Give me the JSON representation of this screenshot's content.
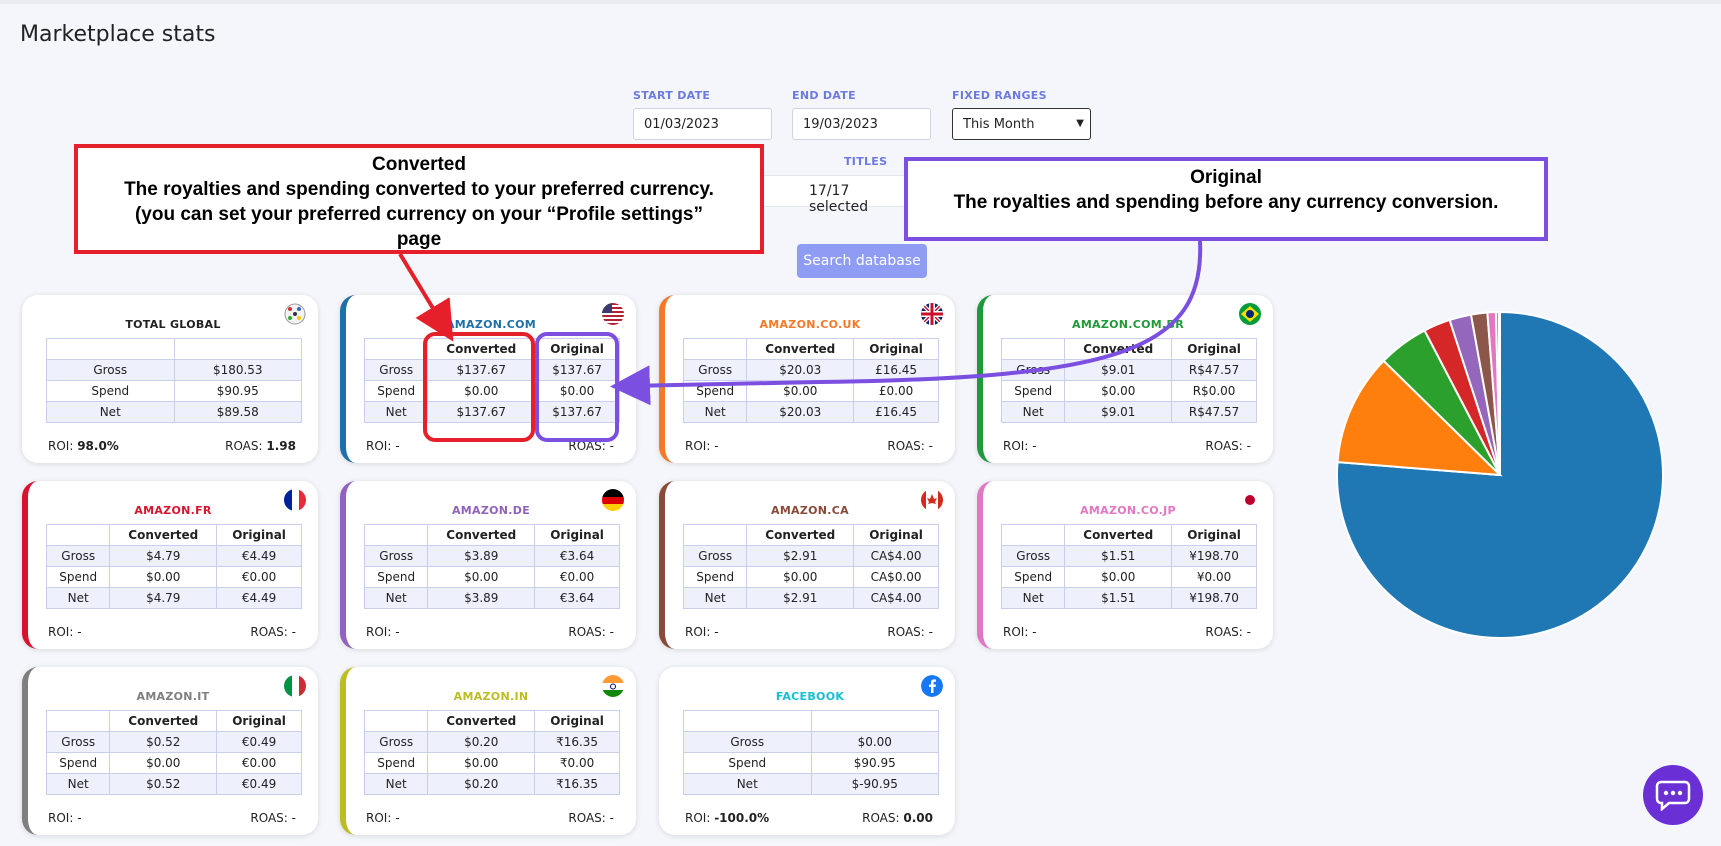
{
  "page": {
    "title": "Marketplace stats"
  },
  "filters": {
    "start_label": "START DATE",
    "start_value": "01/03/2023",
    "end_label": "END DATE",
    "end_value": "19/03/2023",
    "ranges_label": "FIXED RANGES",
    "ranges_value": "This Month",
    "titles_label": "TITLES",
    "titles_value": "17/17 selected",
    "search_button": "Search database"
  },
  "annotations": {
    "converted_title": "Converted",
    "converted_line1": "The royalties and spending converted to your preferred currency.",
    "converted_line2": "(you can set your preferred currency on your “Profile settings”",
    "converted_line3": "page",
    "original_title": "Original",
    "original_line1": "The royalties and spending before any currency conversion."
  },
  "labels": {
    "converted": "Converted",
    "original": "Original",
    "gross": "Gross",
    "spend": "Spend",
    "net": "Net",
    "roi": "ROI:",
    "roas": "ROAS:"
  },
  "cards": [
    {
      "name": "TOTAL GLOBAL",
      "color": "#222222",
      "flag": "globe",
      "gross_c": "$180.53",
      "spend_c": "$90.95",
      "net_c": "$89.58",
      "roi": "98.0%",
      "roas": "1.98"
    },
    {
      "name": "AMAZON.COM",
      "color": "#1f6fa8",
      "flag": "us",
      "gross_c": "$137.67",
      "gross_o": "$137.67",
      "spend_c": "$0.00",
      "spend_o": "$0.00",
      "net_c": "$137.67",
      "net_o": "$137.67",
      "roi": "-",
      "roas": "-"
    },
    {
      "name": "AMAZON.CO.UK",
      "color": "#f47a2a",
      "flag": "uk",
      "gross_c": "$20.03",
      "gross_o": "£16.45",
      "spend_c": "$0.00",
      "spend_o": "£0.00",
      "net_c": "$20.03",
      "net_o": "£16.45",
      "roi": "-",
      "roas": "-"
    },
    {
      "name": "AMAZON.COM.BR",
      "color": "#1f9a3a",
      "flag": "br",
      "gross_c": "$9.01",
      "gross_o": "R$47.57",
      "spend_c": "$0.00",
      "spend_o": "R$0.00",
      "net_c": "$9.01",
      "net_o": "R$47.57",
      "roi": "-",
      "roas": "-"
    },
    {
      "name": "AMAZON.FR",
      "color": "#d9122e",
      "flag": "fr",
      "gross_c": "$4.79",
      "gross_o": "€4.49",
      "spend_c": "$0.00",
      "spend_o": "€0.00",
      "net_c": "$4.79",
      "net_o": "€4.49",
      "roi": "-",
      "roas": "-"
    },
    {
      "name": "AMAZON.DE",
      "color": "#9062bd",
      "flag": "de",
      "gross_c": "$3.89",
      "gross_o": "€3.64",
      "spend_c": "$0.00",
      "spend_o": "€0.00",
      "net_c": "$3.89",
      "net_o": "€3.64",
      "roi": "-",
      "roas": "-"
    },
    {
      "name": "AMAZON.CA",
      "color": "#8a4a3a",
      "flag": "ca",
      "gross_c": "$2.91",
      "gross_o": "CA$4.00",
      "spend_c": "$0.00",
      "spend_o": "CA$0.00",
      "net_c": "$2.91",
      "net_o": "CA$4.00",
      "roi": "-",
      "roas": "-"
    },
    {
      "name": "AMAZON.CO.JP",
      "color": "#e376c2",
      "flag": "jp",
      "gross_c": "$1.51",
      "gross_o": "¥198.70",
      "spend_c": "$0.00",
      "spend_o": "¥0.00",
      "net_c": "$1.51",
      "net_o": "¥198.70",
      "roi": "-",
      "roas": "-"
    },
    {
      "name": "AMAZON.IT",
      "color": "#7f7f7f",
      "flag": "it",
      "gross_c": "$0.52",
      "gross_o": "€0.49",
      "spend_c": "$0.00",
      "spend_o": "€0.00",
      "net_c": "$0.52",
      "net_o": "€0.49",
      "roi": "-",
      "roas": "-"
    },
    {
      "name": "AMAZON.IN",
      "color": "#bcbd22",
      "flag": "in",
      "gross_c": "$0.20",
      "gross_o": "₹16.35",
      "spend_c": "$0.00",
      "spend_o": "₹0.00",
      "net_c": "$0.20",
      "net_o": "₹16.35",
      "roi": "-",
      "roas": "-"
    },
    {
      "name": "FACEBOOK",
      "color": "#17becf",
      "flag": "fb",
      "gross_c": "$0.00",
      "spend_c": "$90.95",
      "net_c": "$-90.95",
      "roi": "-100.0%",
      "roas": "0.00"
    }
  ],
  "chart_data": {
    "type": "pie",
    "categories": [
      "AMAZON.COM",
      "AMAZON.CO.UK",
      "AMAZON.COM.BR",
      "AMAZON.FR",
      "AMAZON.DE",
      "AMAZON.CA",
      "AMAZON.CO.JP",
      "AMAZON.IT",
      "AMAZON.IN"
    ],
    "values": [
      137.67,
      20.03,
      9.01,
      4.79,
      3.89,
      2.91,
      1.51,
      0.52,
      0.2
    ],
    "colors": [
      "#1f77b4",
      "#ff7f0e",
      "#2ca02c",
      "#d62728",
      "#9467bd",
      "#8c564b",
      "#e377c2",
      "#7f7f7f",
      "#bcbd22"
    ],
    "start_angle_deg": 0,
    "direction": "clockwise",
    "legend": "none"
  }
}
